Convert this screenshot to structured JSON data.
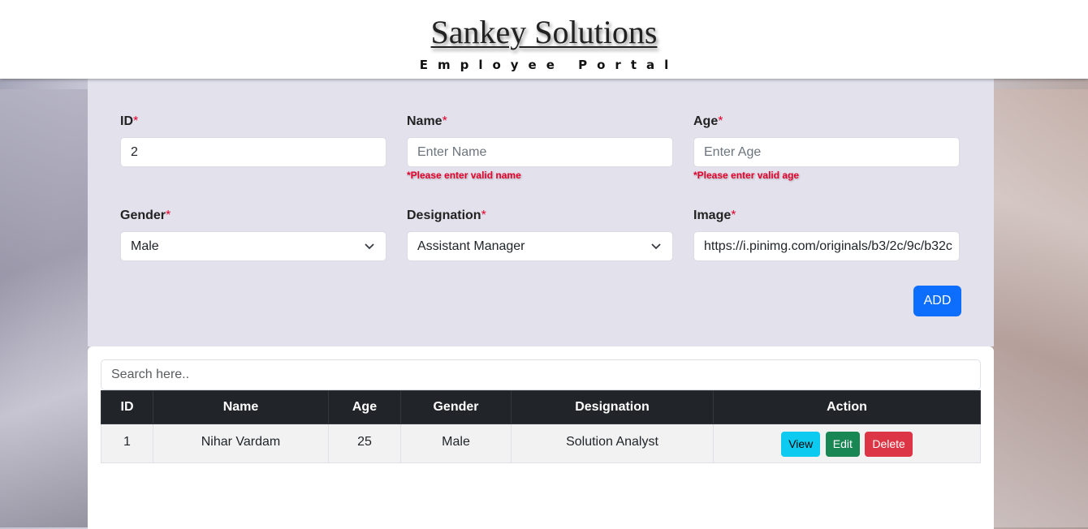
{
  "header": {
    "brand": "Sankey Solutions",
    "tagline": "Employee Portal"
  },
  "form": {
    "required_mark": "*",
    "id": {
      "label": "ID",
      "value": "2"
    },
    "name": {
      "label": "Name",
      "placeholder": "Enter Name",
      "error": "*Please enter valid name"
    },
    "age": {
      "label": "Age",
      "placeholder": "Enter Age",
      "error": "*Please enter valid age"
    },
    "gender": {
      "label": "Gender",
      "selected": "Male"
    },
    "designation": {
      "label": "Designation",
      "selected": "Assistant Manager"
    },
    "image": {
      "label": "Image",
      "value": "https://i.pinimg.com/originals/b3/2c/9c/b32c"
    },
    "add_label": "ADD"
  },
  "table": {
    "search_placeholder": "Search here..",
    "columns": [
      "ID",
      "Name",
      "Age",
      "Gender",
      "Designation",
      "Action"
    ],
    "rows": [
      {
        "id": "1",
        "name": "Nihar Vardam",
        "age": "25",
        "gender": "Male",
        "designation": "Solution Analyst"
      }
    ],
    "actions": {
      "view": "View",
      "edit": "Edit",
      "delete": "Delete"
    }
  },
  "colors": {
    "primary": "#0d6efd",
    "view": "#0dcaf0",
    "edit": "#198754",
    "delete": "#dc3545",
    "error": "#e4002b",
    "table_header": "#212529"
  },
  "icons": {
    "select_arrow": "chevron-down-icon"
  }
}
